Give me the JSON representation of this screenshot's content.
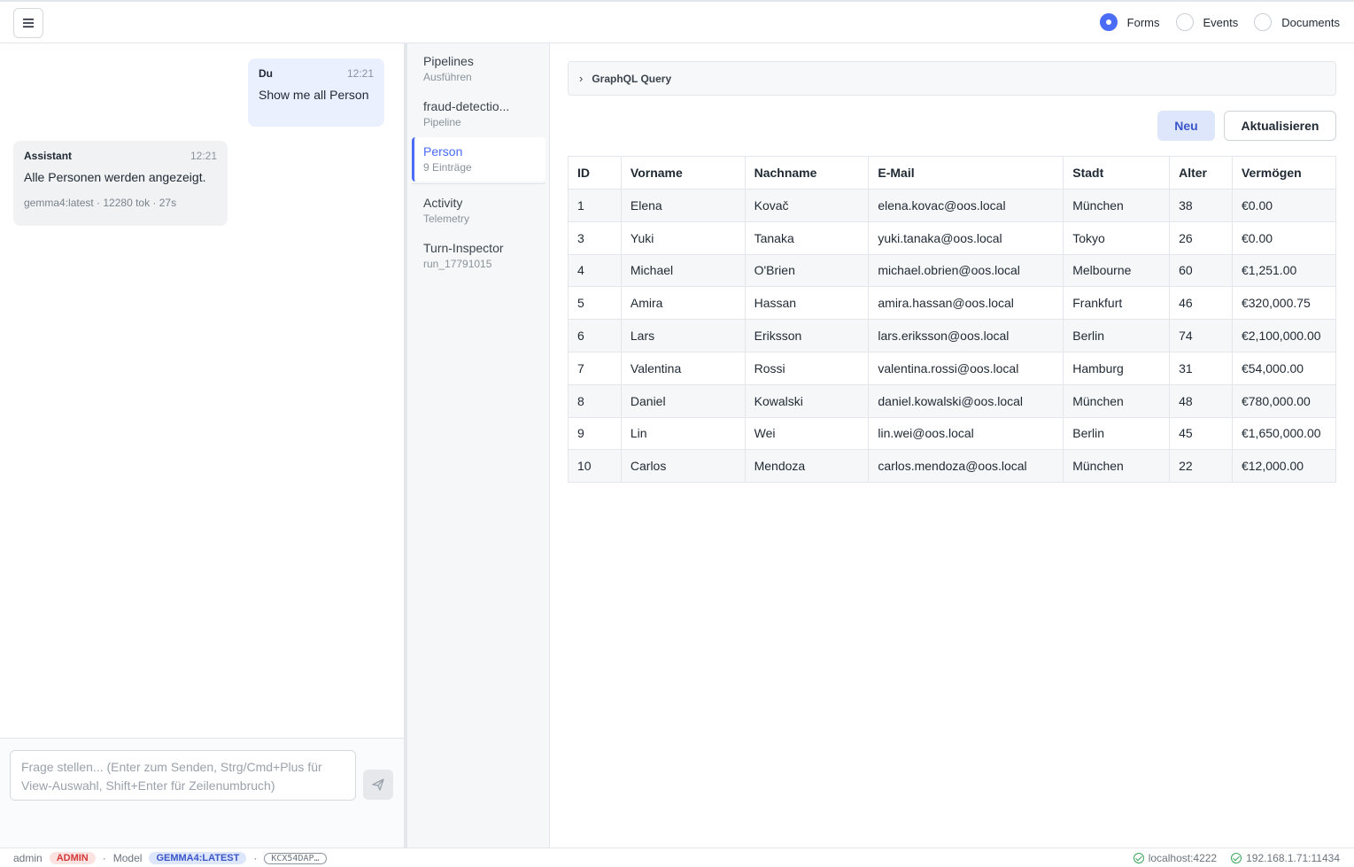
{
  "header": {
    "views": [
      {
        "label": "Forms",
        "checked": true
      },
      {
        "label": "Events",
        "checked": false
      },
      {
        "label": "Documents",
        "checked": false
      }
    ]
  },
  "chat": {
    "messages": [
      {
        "author": "Du",
        "time": "12:21",
        "text": "Show me all Person"
      },
      {
        "author": "Assistant",
        "time": "12:21",
        "text": "Alle Personen werden angezeigt.",
        "meta": "gemma4:latest · 12280 tok · 27s"
      }
    ],
    "input_placeholder": "Frage stellen... (Enter zum Senden, Strg/Cmd+Plus für View-Auswahl, Shift+Enter für Zeilenumbruch)"
  },
  "nav": {
    "items": [
      {
        "title": "Pipelines",
        "subtitle": "Ausführen"
      },
      {
        "title": "fraud-detectio...",
        "subtitle": "Pipeline"
      },
      {
        "title": "Person",
        "subtitle": "9 Einträge"
      },
      {
        "title": "Activity",
        "subtitle": "Telemetry"
      },
      {
        "title": "Turn-Inspector",
        "subtitle": "run_17791015"
      }
    ]
  },
  "main": {
    "graphql_label": "GraphQL Query",
    "new_label": "Neu",
    "refresh_label": "Aktualisieren",
    "table": {
      "columns": [
        "ID",
        "Vorname",
        "Nachname",
        "E-Mail",
        "Stadt",
        "Alter",
        "Vermögen"
      ],
      "rows": [
        [
          "1",
          "Elena",
          "Kovač",
          "elena.kovac@oos.local",
          "München",
          "38",
          "€0.00"
        ],
        [
          "3",
          "Yuki",
          "Tanaka",
          "yuki.tanaka@oos.local",
          "Tokyo",
          "26",
          "€0.00"
        ],
        [
          "4",
          "Michael",
          "O'Brien",
          "michael.obrien@oos.local",
          "Melbourne",
          "60",
          "€1,251.00"
        ],
        [
          "5",
          "Amira",
          "Hassan",
          "amira.hassan@oos.local",
          "Frankfurt",
          "46",
          "€320,000.75"
        ],
        [
          "6",
          "Lars",
          "Eriksson",
          "lars.eriksson@oos.local",
          "Berlin",
          "74",
          "€2,100,000.00"
        ],
        [
          "7",
          "Valentina",
          "Rossi",
          "valentina.rossi@oos.local",
          "Hamburg",
          "31",
          "€54,000.00"
        ],
        [
          "8",
          "Daniel",
          "Kowalski",
          "daniel.kowalski@oos.local",
          "München",
          "48",
          "€780,000.00"
        ],
        [
          "9",
          "Lin",
          "Wei",
          "lin.wei@oos.local",
          "Berlin",
          "45",
          "€1,650,000.00"
        ],
        [
          "10",
          "Carlos",
          "Mendoza",
          "carlos.mendoza@oos.local",
          "München",
          "22",
          "€12,000.00"
        ]
      ]
    }
  },
  "statusbar": {
    "user": "admin",
    "role": "ADMIN",
    "sep": "·",
    "model_label": "Model",
    "model": "GEMMA4:LATEST",
    "session_id": "KCX54DAP…",
    "hosts": [
      "localhost:4222",
      "192.168.1.71:11434"
    ]
  },
  "colors": {
    "accent": "#4a6cf7",
    "success": "#3ba55c",
    "danger": "#d33a3a"
  }
}
